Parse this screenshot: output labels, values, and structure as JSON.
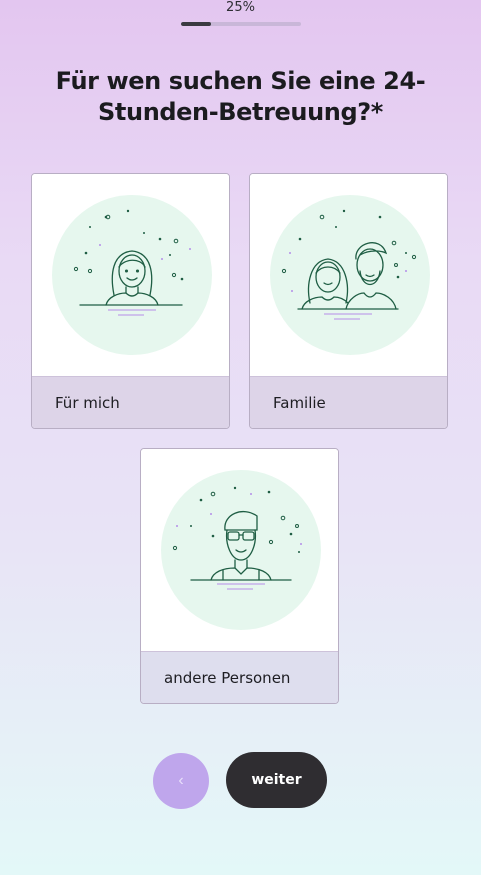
{
  "progress": {
    "text": "25%",
    "value": 0.25
  },
  "question": "Für wen suchen Sie eine 24-Stunden-Betreuung?*",
  "options": [
    {
      "label": "Für mich",
      "icon": "woman-portrait-icon"
    },
    {
      "label": "Familie",
      "icon": "couple-portrait-icon"
    },
    {
      "label": "andere Personen",
      "icon": "man-with-glasses-portrait-icon"
    }
  ],
  "nav": {
    "back_icon": "chevron-left-icon",
    "back_glyph": "‹",
    "next_label": "weiter"
  },
  "colors": {
    "accent": "#bfa6ec",
    "primary_button": "#2f2d31",
    "illustration_bg": "#e6f7ee",
    "illustration_line": "#1f5e44"
  }
}
